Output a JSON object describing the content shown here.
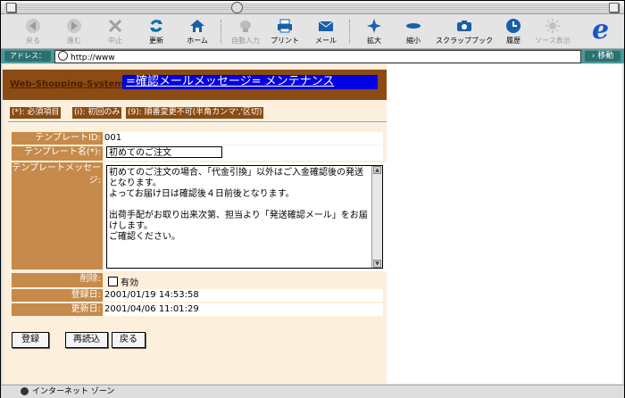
{
  "toolbar": {
    "back": "戻る",
    "forward": "進む",
    "stop": "中止",
    "refresh": "更新",
    "home": "ホーム",
    "autofill": "自動入力",
    "print": "プリント",
    "mail": "メール",
    "zoom_in": "拡大",
    "zoom_out": "縮小",
    "scrapbook": "スクラップブック",
    "history": "履歴",
    "view_source": "ソース表示"
  },
  "address": {
    "label": "アドレス：",
    "url": "http://www",
    "go": "移動"
  },
  "page": {
    "system": "Web-Shopping-System",
    "title": "=確認メールメッセージ= メンテナンス",
    "legend": [
      "(*): 必須項目",
      "(i): 初回のみ",
      "(9): 順番変更不可(半角カンマ','区切)"
    ],
    "form": {
      "template_id_label": "テンプレートID:",
      "template_id": "001",
      "template_name_label": "テンプレート名(*):",
      "template_name": "初めてのご注文",
      "message_label": "テンプレートメッセージ:",
      "message": "初めてのご注文の場合、「代金引換」以外はご入金確認後の発送となります。\nよってお届け日は確認後４日前後となります。\n\n出荷手配がお取り出来次第、担当より「発送確認メール」をお届けします。\nご確認ください。",
      "delete_label": "削除:",
      "delete_option": "有効",
      "registered_label": "登録日:",
      "registered": "2001/01/19 14:53:58",
      "updated_label": "更新日:",
      "updated": "2001/04/06 11:01:29"
    },
    "buttons": {
      "register": "登録",
      "reload": "再読込",
      "back": "戻る"
    }
  },
  "status": {
    "zone": "インターネット ゾーン"
  }
}
